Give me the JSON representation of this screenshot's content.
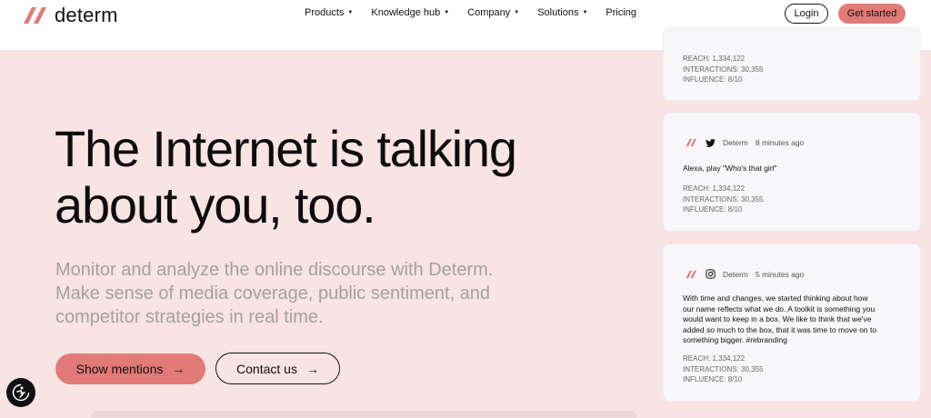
{
  "header": {
    "logo_text": "determ",
    "nav": [
      {
        "label": "Products",
        "dropdown": true
      },
      {
        "label": "Knowledge hub",
        "dropdown": true
      },
      {
        "label": "Company",
        "dropdown": true
      },
      {
        "label": "Solutions",
        "dropdown": true
      },
      {
        "label": "Pricing",
        "dropdown": false
      }
    ],
    "login_label": "Login",
    "get_started_label": "Get started"
  },
  "hero": {
    "title_line1": "The Internet is talking",
    "title_line2": "about you, too.",
    "subtitle_line1": "Monitor and analyze the online discourse with Determ.",
    "subtitle_line2": "Make sense of media coverage, public sentiment, and",
    "subtitle_line3": "competitor strategies in real time.",
    "primary_button": "Show mentions",
    "secondary_button": "Contact us",
    "arrow_glyph": "→"
  },
  "cards": [
    {
      "reach": "REACH: 1,334,122",
      "interactions": "INTERACTIONS: 30,355",
      "influence": "INFLUENCE: 8/10"
    },
    {
      "source_icon": "twitter-icon",
      "author": "Determ",
      "time": "8 minutes ago",
      "text": "Alexa, play \"Who's that girl\"",
      "reach": "REACH: 1,334,122",
      "interactions": "INTERACTIONS: 30,355",
      "influence": "INFLUENCE: 8/10"
    },
    {
      "source_icon": "instagram-icon",
      "author": "Determ",
      "time": "5 minutes ago",
      "text_lines": [
        "With time and changes, we started thinking about how",
        "our name reflects what we do. A toolkit is something you",
        "would want to keep in a box. We like to think that we've",
        "added so much to the box, that it was time to move on to",
        "something bigger. #rebranding"
      ],
      "reach": "REACH: 1,334,122",
      "interactions": "INTERACTIONS: 30,355",
      "influence": "INFLUENCE: 8/10"
    }
  ],
  "colors": {
    "accent": "#e27a77",
    "hero_background": "#f8e4e3",
    "subtitle_gray": "#a5a0a0"
  }
}
